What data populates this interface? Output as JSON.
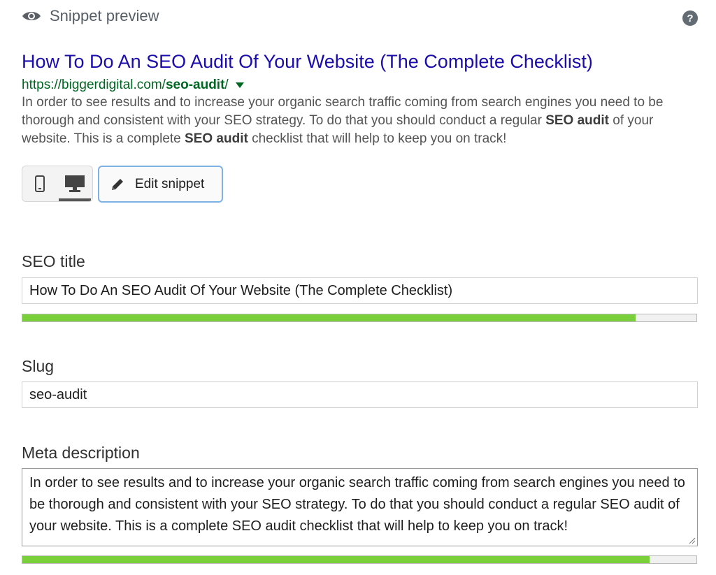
{
  "header": {
    "label": "Snippet preview",
    "help_symbol": "?",
    "icons": {
      "preview": "eye-icon",
      "help": "question-circle-icon"
    }
  },
  "snippet": {
    "title": "How To Do An SEO Audit Of Your Website (The Complete Checklist)",
    "url_base": "https://biggerdigital.com/",
    "url_slug": "seo-audit",
    "url_trailing": "/",
    "description_parts": {
      "p1": "In order to see results and to increase your organic search traffic coming from search engines you need to be thorough and consistent with your SEO strategy. To do that you should conduct a regular ",
      "b1": "SEO audit",
      "p2": " of your website. This is a complete ",
      "b2": "SEO audit",
      "p3": " checklist that will help to keep you on track!"
    }
  },
  "mode_switcher": {
    "options": [
      {
        "name": "mobile",
        "icon": "mobile-phone-icon",
        "active": false
      },
      {
        "name": "desktop",
        "icon": "desktop-monitor-icon",
        "active": true
      }
    ]
  },
  "edit_button": {
    "label": "Edit snippet",
    "icon": "pencil-icon"
  },
  "fields": {
    "seo_title": {
      "label": "SEO title",
      "value": "How To Do An SEO Audit Of Your Website (The Complete Checklist)",
      "progress_percent": 91
    },
    "slug": {
      "label": "Slug",
      "value": "seo-audit"
    },
    "meta_description": {
      "label": "Meta description",
      "value": "In order to see results and to increase your organic search traffic coming from search engines you need to be thorough and consistent with your SEO strategy. To do that you should conduct a regular SEO audit of your website. This is a complete SEO audit checklist that will help to keep you on track!",
      "progress_percent": 93
    }
  },
  "colors": {
    "link_title": "#1a0dab",
    "url_green": "#006621",
    "progress_good": "#7ad03a",
    "focus_border": "#7fb2e4"
  }
}
